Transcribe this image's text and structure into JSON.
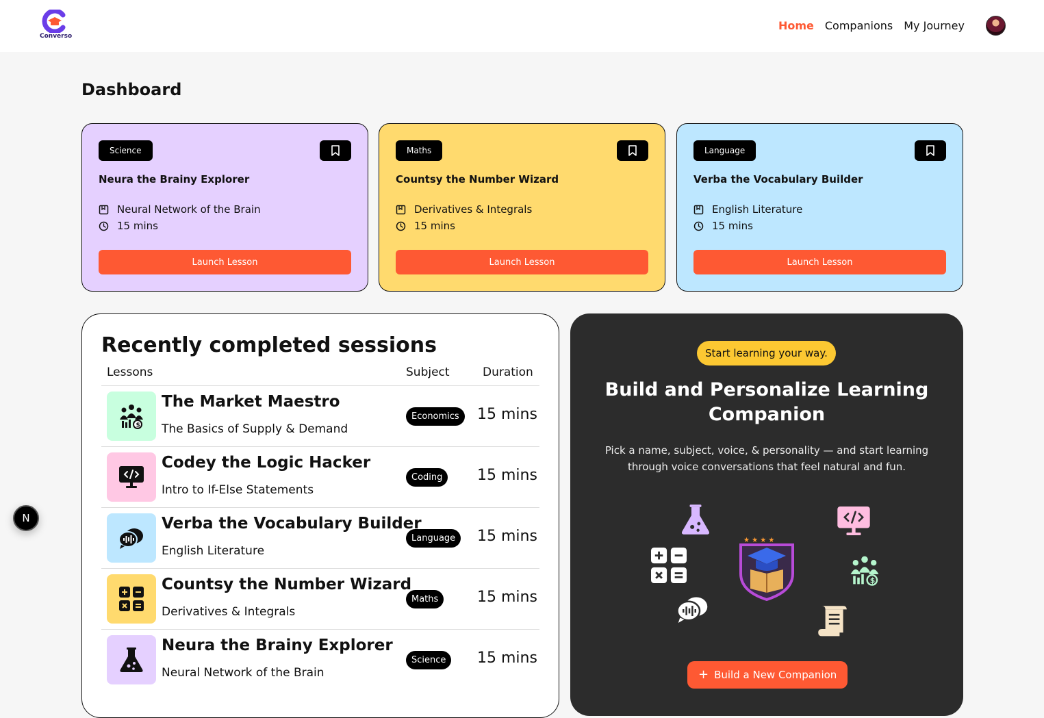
{
  "brand": {
    "name": "Converso"
  },
  "nav": {
    "items": [
      {
        "label": "Home",
        "active": true
      },
      {
        "label": "Companions",
        "active": false
      },
      {
        "label": "My Journey",
        "active": false
      }
    ]
  },
  "page": {
    "title": "Dashboard"
  },
  "companion_cards": [
    {
      "subject": "Science",
      "name": "Neura the Brainy Explorer",
      "topic": "Neural Network of the Brain",
      "duration": "15 mins",
      "button": "Launch Lesson",
      "color": "#e5d0ff"
    },
    {
      "subject": "Maths",
      "name": "Countsy the Number Wizard",
      "topic": "Derivatives & Integrals",
      "duration": "15 mins",
      "button": "Launch Lesson",
      "color": "#ffda6e"
    },
    {
      "subject": "Language",
      "name": "Verba the Vocabulary Builder",
      "topic": "English Literature",
      "duration": "15 mins",
      "button": "Launch Lesson",
      "color": "#bde7ff"
    }
  ],
  "sessions": {
    "title": "Recently completed sessions",
    "columns": [
      "Lessons",
      "Subject",
      "Duration"
    ],
    "rows": [
      {
        "name": "The Market Maestro",
        "topic": "The Basics of Supply & Demand",
        "subject": "Economics",
        "duration": "15 mins",
        "icon": "economics-icon",
        "color": "#c8ffdf"
      },
      {
        "name": "Codey the Logic Hacker",
        "topic": "Intro to If-Else Statements",
        "subject": "Coding",
        "duration": "15 mins",
        "icon": "coding-icon",
        "color": "#ffc8e4"
      },
      {
        "name": "Verba the Vocabulary Builder",
        "topic": "English Literature",
        "subject": "Language",
        "duration": "15 mins",
        "icon": "language-icon",
        "color": "#bde7ff"
      },
      {
        "name": "Countsy the Number Wizard",
        "topic": "Derivatives & Integrals",
        "subject": "Maths",
        "duration": "15 mins",
        "icon": "maths-icon",
        "color": "#ffda6e"
      },
      {
        "name": "Neura the Brainy Explorer",
        "topic": "Neural Network of the Brain",
        "subject": "Science",
        "duration": "15 mins",
        "icon": "science-icon",
        "color": "#e5d0ff"
      }
    ]
  },
  "cta": {
    "pill": "Start learning your way.",
    "title": "Build and Personalize Learning Companion",
    "text": "Pick a name, subject, voice, & personality — and start learning through voice conversations that feel natural and fun.",
    "button": "Build a New Companion"
  },
  "dev_badge": {
    "label": "N"
  },
  "colors": {
    "primary": "#fe5933",
    "dark": "#2c2c2c",
    "pill": "#fcc832"
  }
}
